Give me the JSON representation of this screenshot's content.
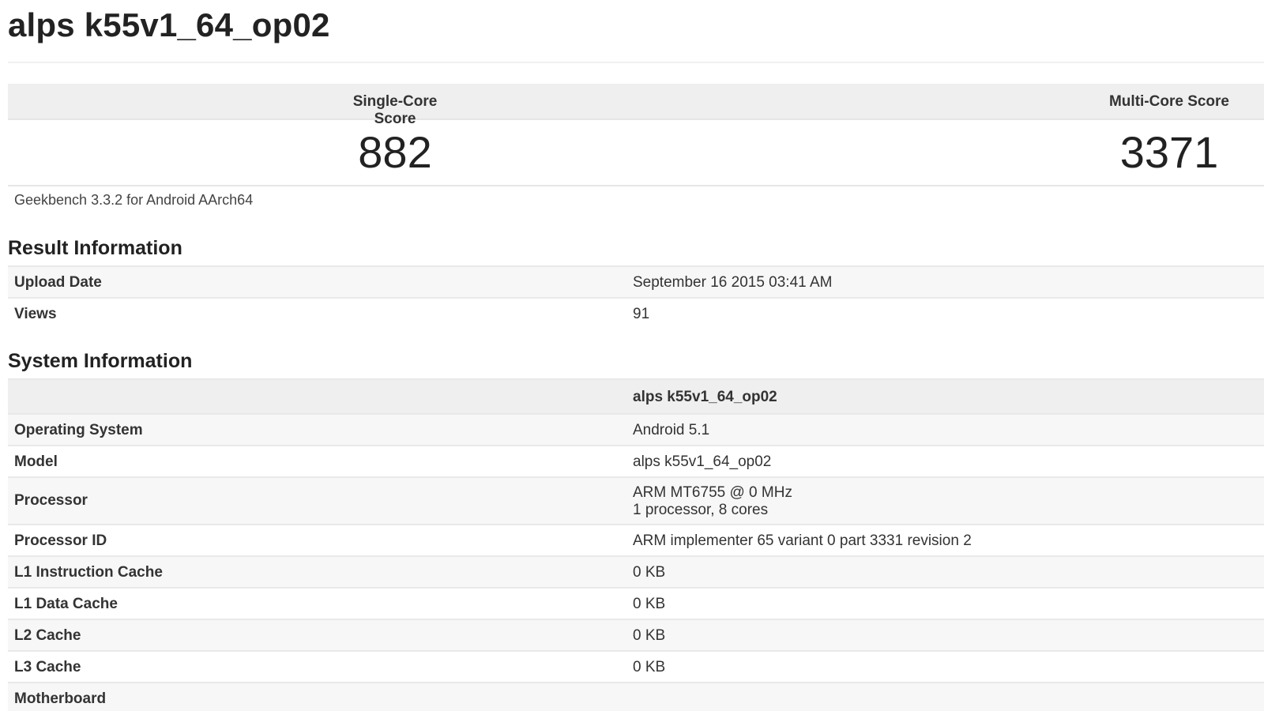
{
  "page_title": "alps k55v1_64_op02",
  "scores": {
    "single_core_label": "Single-Core Score",
    "multi_core_label": "Multi-Core Score",
    "single_core_value": "882",
    "multi_core_value": "3371"
  },
  "version_note": "Geekbench 3.3.2 for Android AArch64",
  "result_information": {
    "title": "Result Information",
    "rows": [
      {
        "label": "Upload Date",
        "value": "September 16 2015 03:41 AM"
      },
      {
        "label": "Views",
        "value": "91"
      }
    ]
  },
  "system_information": {
    "title": "System Information",
    "header_value": "alps k55v1_64_op02",
    "rows": [
      {
        "label": "Operating System",
        "value": "Android 5.1"
      },
      {
        "label": "Model",
        "value": "alps k55v1_64_op02"
      },
      {
        "label": "Processor",
        "value": "ARM MT6755 @ 0 MHz",
        "value_line2": "1 processor, 8 cores"
      },
      {
        "label": "Processor ID",
        "value": "ARM implementer 65 variant 0 part 3331 revision 2"
      },
      {
        "label": "L1 Instruction Cache",
        "value": "0 KB"
      },
      {
        "label": "L1 Data Cache",
        "value": "0 KB"
      },
      {
        "label": "L2 Cache",
        "value": "0 KB"
      },
      {
        "label": "L3 Cache",
        "value": "0 KB"
      },
      {
        "label": "Motherboard",
        "value": ""
      }
    ]
  },
  "colors": {
    "header_background": "#efefef",
    "row_shade": "#f7f7f7",
    "border": "#e9e9e9",
    "text": "#222222"
  }
}
